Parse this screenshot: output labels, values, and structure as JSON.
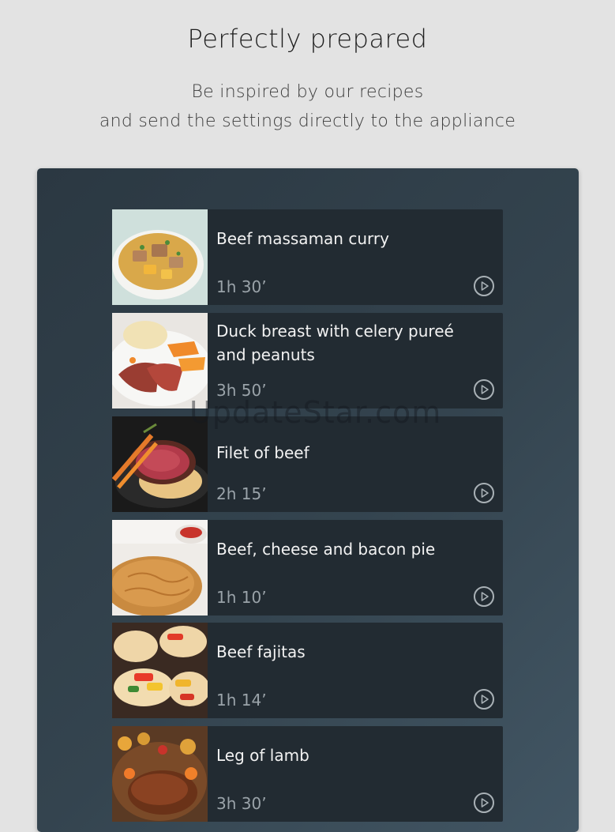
{
  "header": {
    "title": "Perfectly prepared",
    "subtitle_line1": "Be inspired by our recipes",
    "subtitle_line2": "and send the settings directly to the appliance"
  },
  "recipes": [
    {
      "name": "Beef massaman curry",
      "time": "1h 30’",
      "image": "curry-bowl"
    },
    {
      "name": "Duck breast with celery pureé and peanuts",
      "time": "3h 50’",
      "image": "duck-plate"
    },
    {
      "name": "Filet of beef",
      "time": "2h 15’",
      "image": "beef-filet"
    },
    {
      "name": "Beef, cheese and bacon pie",
      "time": "1h 10’",
      "image": "pie"
    },
    {
      "name": "Beef fajitas",
      "time": "1h 14’",
      "image": "fajitas"
    },
    {
      "name": "Leg of lamb",
      "time": "3h 30’",
      "image": "lamb-roast"
    }
  ],
  "watermark": "UpdateStar.com",
  "colors": {
    "background": "#e3e3e3",
    "panel": "#2f3d47",
    "card": "#222b32",
    "title_text": "#f2f2f2",
    "time_text": "#9aa3a9"
  }
}
